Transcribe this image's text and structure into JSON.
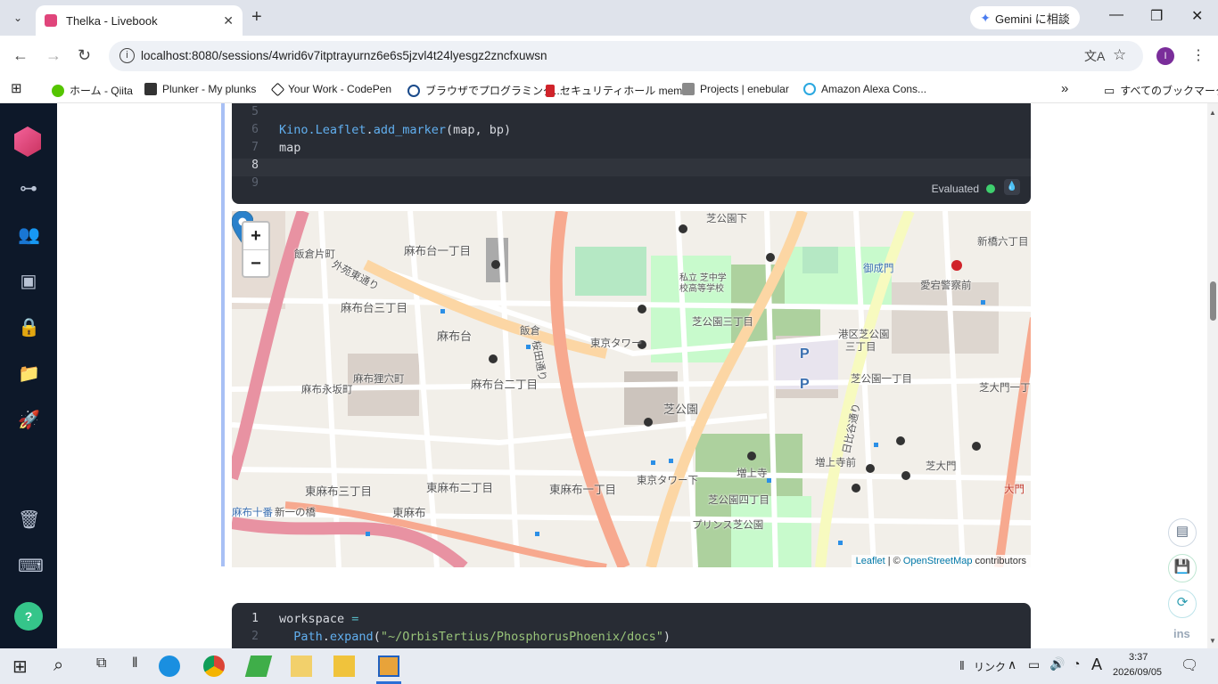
{
  "browser": {
    "tab_title": "Thelka - Livebook",
    "tab_close": "✕",
    "new_tab": "+",
    "gemini_label": "Gemini に相談",
    "url": "localhost:8080/sessions/4wrid6v7itptrayurnz6e6s5jzvl4t24lyesgz2zncfxuwsn",
    "profile_initial": "I",
    "bookmarks": [
      {
        "label": "ホーム - Qiita",
        "color": "#55c500"
      },
      {
        "label": "Plunker - My plunks",
        "color": "#333333"
      },
      {
        "label": "Your Work - CodePen",
        "color": "#111111"
      },
      {
        "label": "ブラウザでプログラミング...",
        "color": "#1a4a8a"
      },
      {
        "label": "セキュリティホール memo",
        "color": "#d0232a"
      },
      {
        "label": "Projects | enebular",
        "color": "#8a8a8a"
      },
      {
        "label": "Amazon Alexa Cons...",
        "color": "#2aa8e0"
      }
    ],
    "bookmarks_more": "»",
    "all_bookmarks": "すべてのブックマーク"
  },
  "cell1": {
    "lines": [
      {
        "no": "5",
        "text": ""
      },
      {
        "no": "6",
        "mod": "Kino.Leaflet",
        "dot": ".",
        "fn": "add_marker",
        "rest": "(map, bp)"
      },
      {
        "no": "7",
        "text": "map"
      },
      {
        "no": "8",
        "text": ""
      },
      {
        "no": "9",
        "text": ""
      }
    ],
    "status": "Evaluated"
  },
  "map": {
    "zoom_in": "+",
    "zoom_out": "−",
    "attribution_leaflet": "Leaflet",
    "attribution_sep": " | © ",
    "attribution_osm": "OpenStreetMap",
    "attribution_rest": " contributors",
    "labels": [
      "飯倉片町",
      "麻布台一丁目",
      "芝公園下",
      "新橋六丁目",
      "御成門",
      "愛宕警察前",
      "麻布台三丁目",
      "麻布台",
      "飯倉",
      "東京タワー",
      "芝公園三丁目",
      "港区芝公園",
      "三丁目",
      "麻布狸穴町",
      "麻布台二丁目",
      "麻布永坂町",
      "芝公園",
      "芝公園一丁目",
      "芝大門一丁目",
      "東麻布三丁目",
      "東麻布二丁目",
      "東麻布一丁目",
      "増上寺",
      "増上寺前",
      "芝大門",
      "大門",
      "東京タワー下",
      "芝公園四丁目",
      "プリンス芝公園",
      "東麻布",
      "麻布十番",
      "新一の橋",
      "外苑東通り",
      "桜田通り",
      "日比谷通り",
      "私立 芝中学校高等学校",
      "P",
      "P"
    ]
  },
  "cell2": {
    "lines": [
      {
        "no": "1",
        "var": "workspace",
        "op": " ="
      },
      {
        "no": "2",
        "mod": "  Path",
        "dot": ".",
        "fn": "expand",
        "open": "(",
        "str": "\"~/OrbisTertius/PhosphorusPhoenix/docs\"",
        "close": ")"
      }
    ]
  },
  "side_buttons": {
    "ins_label": "ins"
  },
  "taskbar": {
    "ime_label": "リンク",
    "ime_mode": "A",
    "time": "3:37",
    "date": "2026/09/05"
  }
}
